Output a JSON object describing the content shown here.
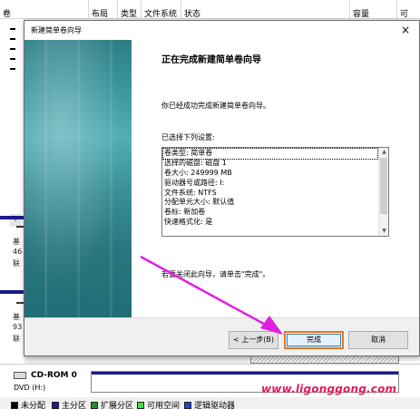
{
  "background": {
    "columns": [
      "卷",
      "布局",
      "类型",
      "文件系统",
      "状态",
      "容量",
      "可"
    ],
    "left_volume_rows": [
      "",
      "",
      "",
      "",
      ""
    ],
    "disk_a": {
      "line1": "基",
      "line2": "46",
      "line3": "联"
    },
    "disk_b": {
      "line1": "基",
      "line2": "93",
      "line3": "联"
    },
    "scroll_left_glyph": "‹",
    "cdrom": {
      "title": "CD-ROM 0",
      "subtitle": "DVD (H:)"
    },
    "legend": [
      {
        "label": "未分配",
        "color": "#000000"
      },
      {
        "label": "主分区",
        "color": "#1b1b8c"
      },
      {
        "label": "扩展分区",
        "color": "#1f8f2c"
      },
      {
        "label": "可用空间",
        "color": "#3de03d"
      },
      {
        "label": "逻辑驱动器",
        "color": "#2240d8"
      }
    ]
  },
  "dialog": {
    "title": "新建简单卷向导",
    "close_glyph": "×",
    "heading": "正在完成新建简单卷向导",
    "description": "你已经成功完成新建简单卷向导。",
    "settings_label": "已选择下列设置:",
    "settings": [
      "卷类型: 简单卷",
      "选择的磁盘: 磁盘 1",
      "卷大小: 249999 MB",
      "驱动器号或路径: I:",
      "文件系统: NTFS",
      "分配单元大小: 默认值",
      "卷标: 新加卷",
      "快速格式化: 是"
    ],
    "finish_note": "若要关闭此向导，请单击\"完成\"。",
    "buttons": {
      "back": "< 上一步(B)",
      "finish": "完成",
      "cancel": "取消"
    }
  },
  "watermark": "www.ligonggong.com",
  "colors": {
    "accent_highlight": "#e87722",
    "arrow": "#e020e0",
    "watermark": "#e0195c",
    "side_panel": "#2d7e86"
  }
}
